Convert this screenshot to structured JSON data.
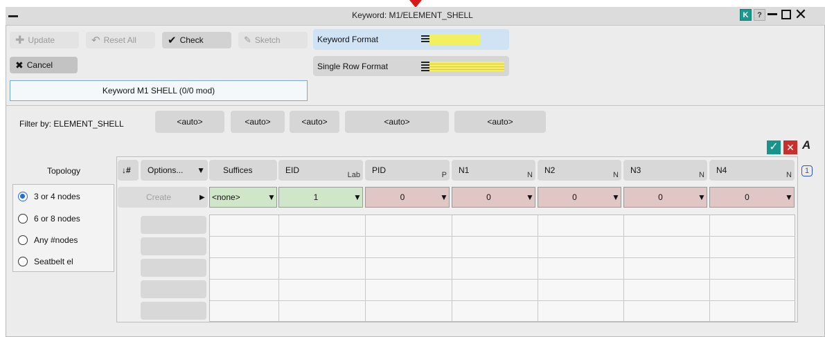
{
  "window": {
    "title": "Keyword: M1/ELEMENT_SHELL",
    "k_label": "K",
    "help_label": "?"
  },
  "toolbar": {
    "update": "Update",
    "reset_all": "Reset All",
    "check": "Check",
    "sketch": "Sketch",
    "cancel": "Cancel",
    "keyword_format": "Keyword Format",
    "single_row_format": "Single Row Format"
  },
  "selection": {
    "label": "Keyword M1 SHELL (0/0 mod)"
  },
  "filter": {
    "label": "Filter by: ELEMENT_SHELL",
    "buttons": [
      "<auto>",
      "<auto>",
      "<auto>",
      "<auto>",
      "<auto>"
    ]
  },
  "topology": {
    "label": "Topology",
    "options": [
      "3 or 4 nodes",
      "6 or 8 nodes",
      "Any #nodes",
      "Seatbelt el"
    ],
    "selected": "3 or 4 nodes"
  },
  "table": {
    "sort_label": "↓#",
    "options_label": "Options...",
    "headers": [
      {
        "label": "Suffices",
        "sub": ""
      },
      {
        "label": "EID",
        "sub": "Lab"
      },
      {
        "label": "PID",
        "sub": "P"
      },
      {
        "label": "N1",
        "sub": "N"
      },
      {
        "label": "N2",
        "sub": "N"
      },
      {
        "label": "N3",
        "sub": "N"
      },
      {
        "label": "N4",
        "sub": "N"
      }
    ],
    "create_label": "Create",
    "row": {
      "suffix": "<none>",
      "eid": "1",
      "pid": "0",
      "n1": "0",
      "n2": "0",
      "n3": "0",
      "n4": "0"
    },
    "page": "1"
  },
  "colors": {
    "accent": "#1f6fd8",
    "teal": "#1a9a8e",
    "red_cell": "#e0c6c5",
    "green_cell": "#cfe6c9",
    "yellow_format": "#f0f060"
  }
}
